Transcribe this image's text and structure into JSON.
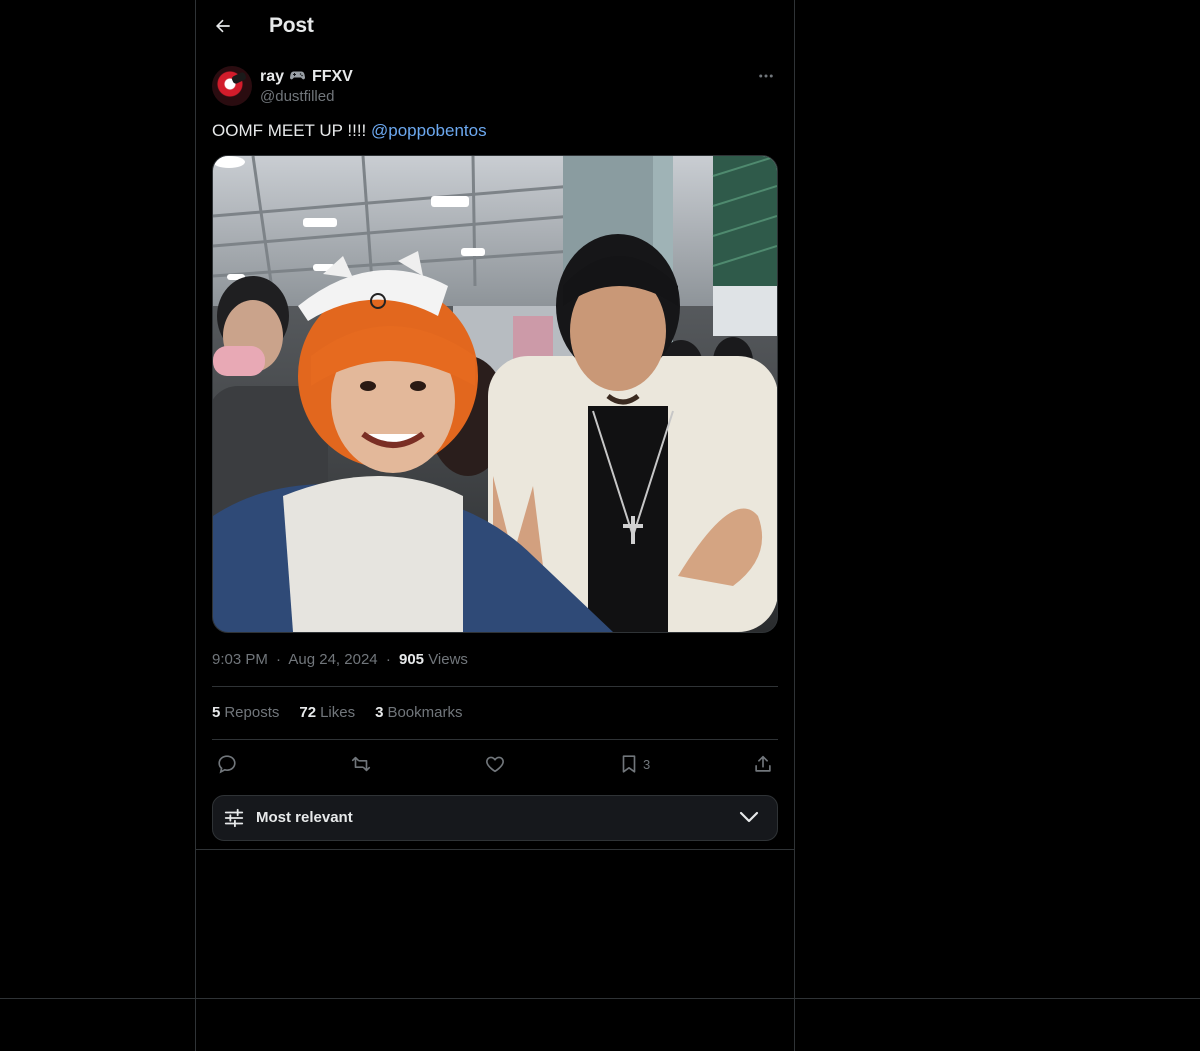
{
  "header": {
    "title": "Post"
  },
  "post": {
    "author": {
      "display_name": "ray",
      "display_name_suffix": "FFXV",
      "handle": "@dustfilled"
    },
    "text": "OOMF MEET UP !!!! ",
    "mention": "@poppobentos",
    "time": "9:03 PM",
    "date": "Aug 24, 2024",
    "views_count": "905",
    "views_label": "Views",
    "separator": "·"
  },
  "stats": {
    "reposts_count": "5",
    "reposts_label": "Reposts",
    "likes_count": "72",
    "likes_label": "Likes",
    "bookmarks_count": "3",
    "bookmarks_label": "Bookmarks"
  },
  "actions": {
    "bookmark_count": "3"
  },
  "sort": {
    "label": "Most relevant"
  },
  "colors": {
    "background": "#000000",
    "text": "#e7e9ea",
    "muted": "#71767b",
    "border": "#2f3336",
    "mention": "#6ca8ef"
  }
}
